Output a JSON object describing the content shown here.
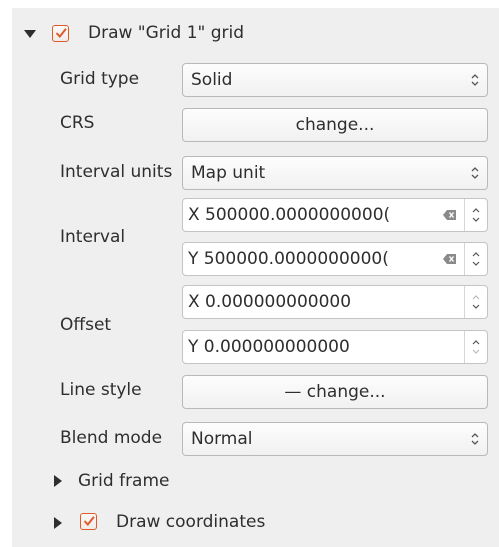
{
  "header": {
    "title": "Draw \"Grid 1\" grid",
    "checked": true
  },
  "grid_type": {
    "label": "Grid type",
    "value": "Solid"
  },
  "crs": {
    "label": "CRS",
    "button": "change..."
  },
  "interval_units": {
    "label": "Interval units",
    "value": "Map unit"
  },
  "interval": {
    "label": "Interval",
    "x": "X 500000.0000000000(",
    "y": "Y 500000.0000000000("
  },
  "offset": {
    "label": "Offset",
    "x": "X 0.000000000000",
    "y": "Y 0.000000000000"
  },
  "line_style": {
    "label": "Line style",
    "button": "— change..."
  },
  "blend_mode": {
    "label": "Blend mode",
    "value": "Normal"
  },
  "grid_frame": {
    "label": "Grid frame"
  },
  "draw_coordinates": {
    "label": "Draw coordinates",
    "checked": true
  },
  "colors": {
    "accent": "#e05a2a",
    "panel_bg": "#efefef"
  },
  "icons": [
    "collapse-arrow-icon",
    "expand-arrow-icon",
    "checkbox-checked-icon",
    "clear-icon",
    "combo-arrows-icon",
    "spin-arrows-icon"
  ]
}
